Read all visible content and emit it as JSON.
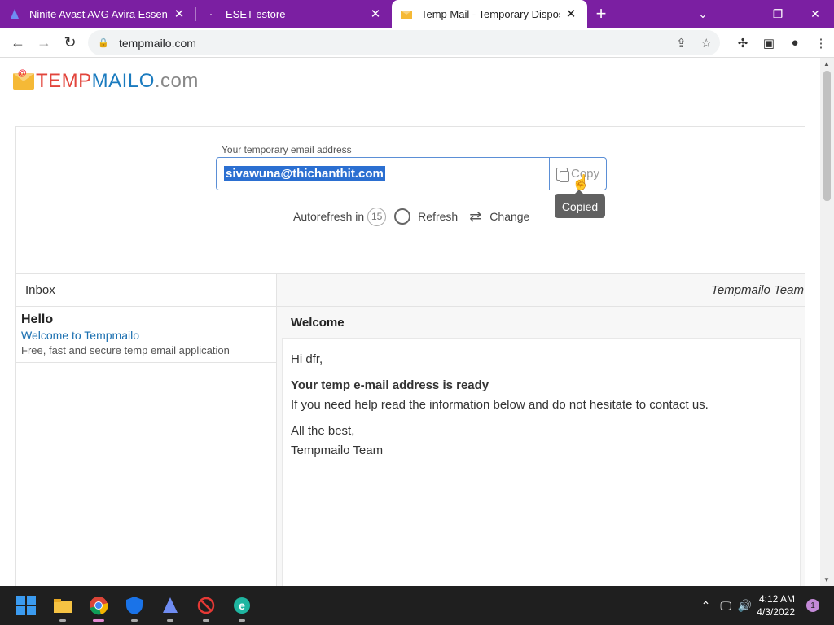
{
  "browser": {
    "tabs": [
      {
        "title": "Ninite Avast AVG Avira Essentials",
        "icon": "ninite-icon"
      },
      {
        "title": "ESET estore",
        "icon": "loading-icon"
      },
      {
        "title": "Temp Mail - Temporary Disposab",
        "icon": "tempmail-icon",
        "active": true
      }
    ],
    "url": "tempmailo.com"
  },
  "site": {
    "logo_a": "TEMP",
    "logo_b": "MAILO",
    "logo_c": ".com",
    "email_label": "Your temporary email address",
    "email": "sivawuna@thichanthit.com",
    "copy_label": "Copy",
    "tooltip": "Copied",
    "autorefresh_label": "Autorefresh in",
    "autorefresh_count": "15",
    "refresh_label": "Refresh",
    "change_label": "Change"
  },
  "inbox": {
    "header": "Inbox",
    "messages": [
      {
        "from": "Hello",
        "subject": "Welcome to Tempmailo",
        "preview": "Free, fast and secure temp email application"
      }
    ]
  },
  "reader": {
    "from": "Tempmailo Team",
    "subject": "Welcome",
    "greeting": "Hi dfr,",
    "heading": "Your temp e-mail address is ready",
    "line": "If you need help read the information below and do not hesitate to contact us.",
    "signoff": "All the best,",
    "signature": "Tempmailo Team"
  },
  "taskbar": {
    "time": "4:12 AM",
    "date": "4/3/2022",
    "notifications": "1"
  }
}
